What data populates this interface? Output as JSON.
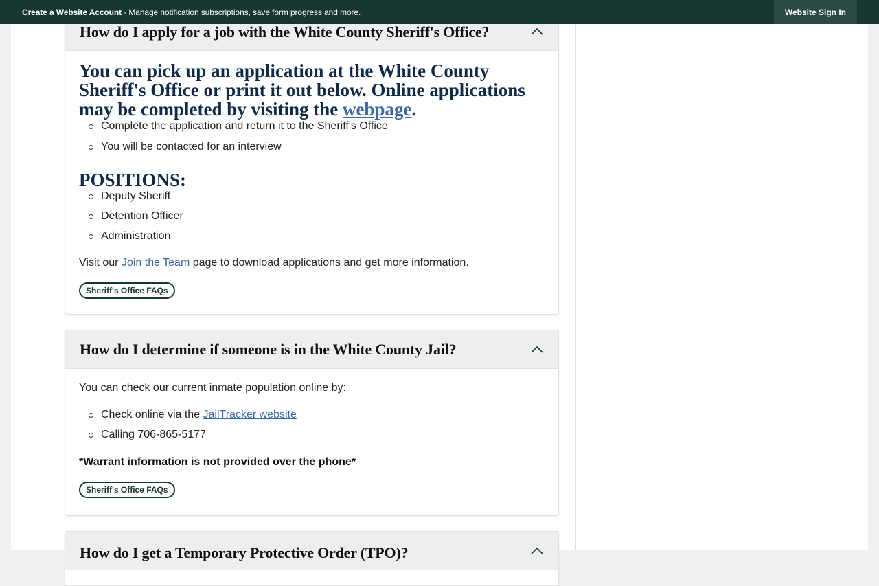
{
  "topbar": {
    "create_account": "Create a Website Account",
    "message": " - Manage notification subscriptions, save form progress and more.",
    "signin": "Website Sign In"
  },
  "faq1": {
    "question": "How do I apply for a job with the White County Sheriff's Office?",
    "heading_text": "You can pick up an application at the White County Sheriff's Office or print it out below. Online applications may be completed by visiting the ",
    "heading_link": "webpage",
    "heading_end": ".",
    "steps": [
      "Complete the application and return it to the Sheriff's Office",
      "You will be contacted for an interview"
    ],
    "positions_heading": "POSITIONS:",
    "positions": [
      "Deputy Sheriff",
      "Detention Officer",
      "Administration"
    ],
    "visit_pre": "Visit our",
    "visit_link": " Join the Team",
    "visit_post": " page to download applications and get more information.",
    "tag": "Sheriff's Office FAQs"
  },
  "faq2": {
    "question": "How do I determine if someone is in the White County Jail?",
    "intro": "You can check our current inmate population online by:",
    "check_pre": "Check online via the ",
    "check_link": "JailTracker website",
    "calling": "Calling 706-865-5177",
    "warning": "*Warrant information is not provided over the phone*",
    "tag": "Sheriff's Office FAQs"
  },
  "faq3": {
    "question": "How do I get a Temporary Protective Order (TPO)?"
  },
  "icons": {
    "chevron": "chevron-up-icon",
    "chevron_color": "#163630"
  },
  "colors": {
    "topbar_bg": "#163630",
    "heading_navy": "#0f2a4a",
    "link_blue": "#3a67a8"
  }
}
